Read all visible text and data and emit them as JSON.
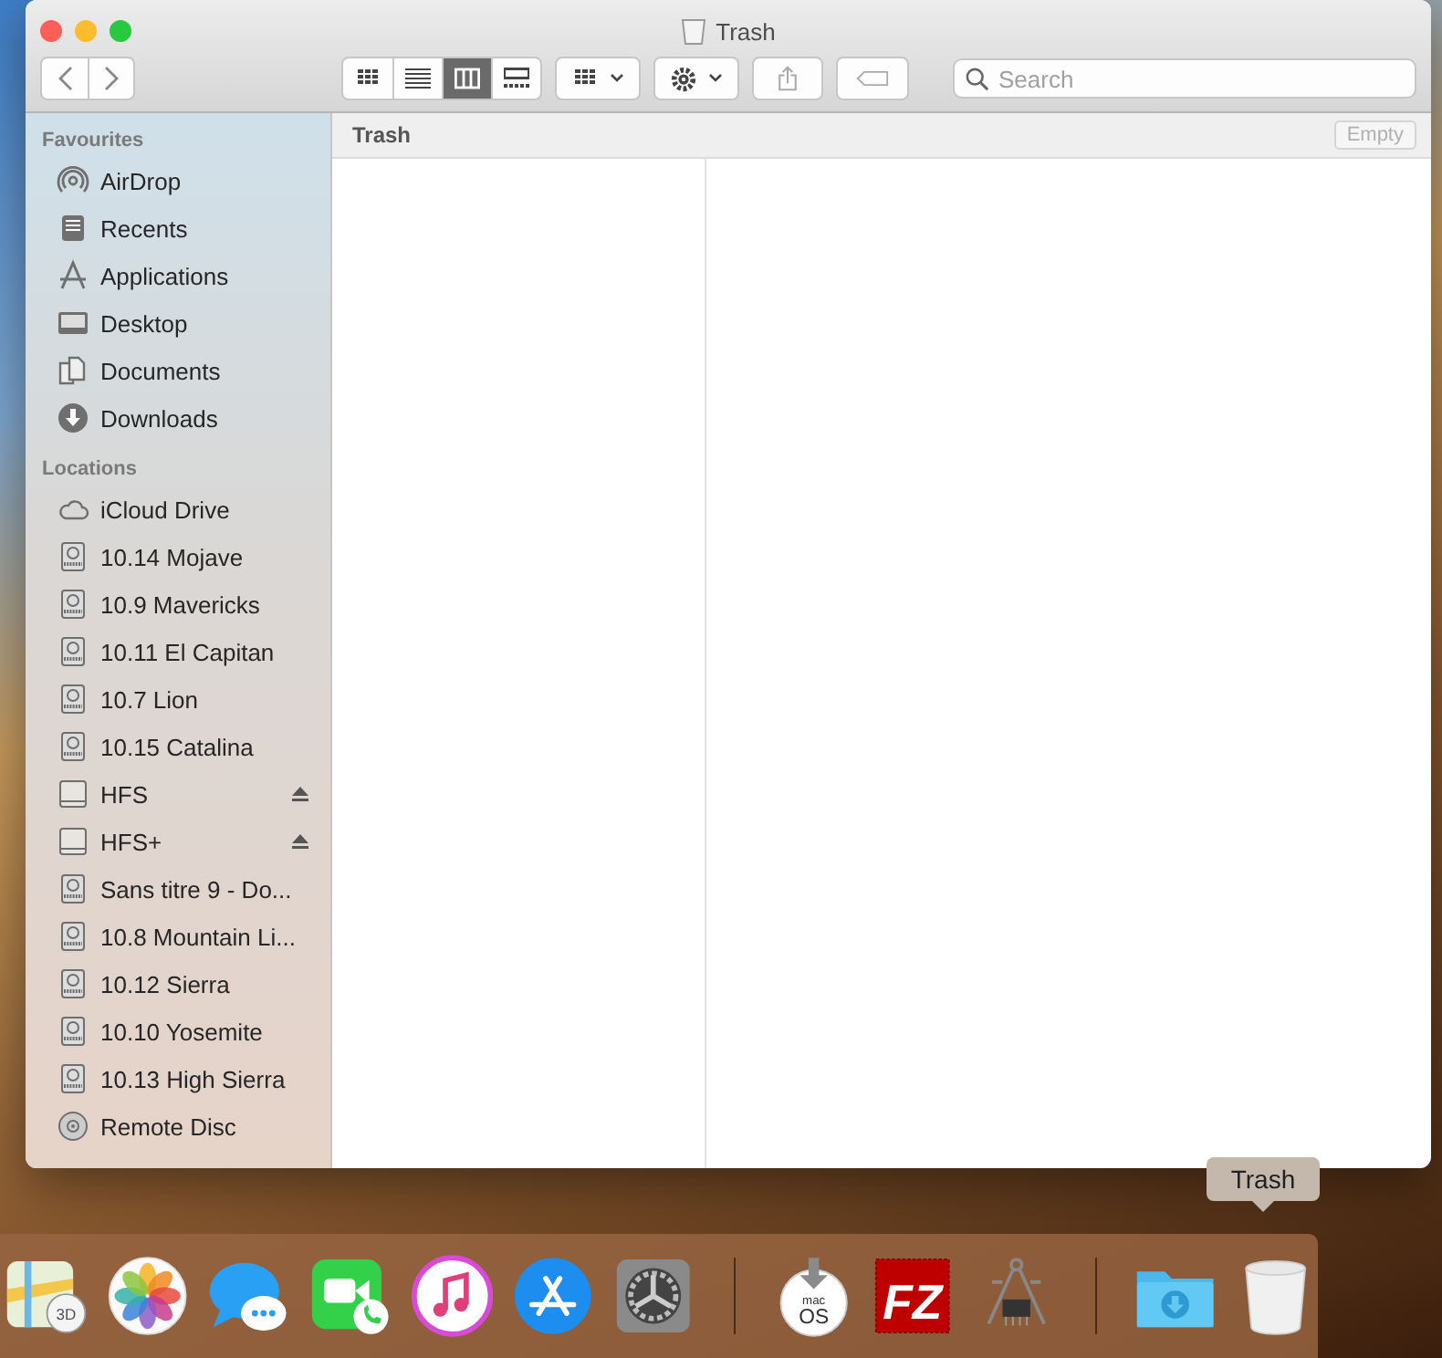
{
  "window": {
    "title": "Trash"
  },
  "toolbar": {
    "views": [
      {
        "kind": "icons",
        "selected": false
      },
      {
        "kind": "list",
        "selected": false
      },
      {
        "kind": "columns",
        "selected": true
      },
      {
        "kind": "gallery",
        "selected": false
      }
    ],
    "search": {
      "placeholder": "Search"
    }
  },
  "sidebar": {
    "sections": [
      {
        "title": "Favourites",
        "items": [
          {
            "label": "AirDrop",
            "kind": "airdrop",
            "ejectable": false
          },
          {
            "label": "Recents",
            "kind": "recents",
            "ejectable": false
          },
          {
            "label": "Applications",
            "kind": "applications",
            "ejectable": false
          },
          {
            "label": "Desktop",
            "kind": "desktop",
            "ejectable": false
          },
          {
            "label": "Documents",
            "kind": "documents",
            "ejectable": false
          },
          {
            "label": "Downloads",
            "kind": "downloads",
            "ejectable": false
          }
        ]
      },
      {
        "title": "Locations",
        "items": [
          {
            "label": "iCloud Drive",
            "kind": "cloud",
            "ejectable": false
          },
          {
            "label": "10.14 Mojave",
            "kind": "disk",
            "ejectable": false
          },
          {
            "label": "10.9 Mavericks",
            "kind": "disk",
            "ejectable": false
          },
          {
            "label": "10.11 El Capitan",
            "kind": "disk",
            "ejectable": false
          },
          {
            "label": "10.7 Lion",
            "kind": "disk",
            "ejectable": false
          },
          {
            "label": "10.15 Catalina",
            "kind": "disk",
            "ejectable": false
          },
          {
            "label": "HFS",
            "kind": "external",
            "ejectable": true
          },
          {
            "label": "HFS+",
            "kind": "external",
            "ejectable": true
          },
          {
            "label": "Sans titre 9 - Do...",
            "kind": "disk",
            "ejectable": false
          },
          {
            "label": "10.8 Mountain Li...",
            "kind": "disk",
            "ejectable": false
          },
          {
            "label": "10.12 Sierra",
            "kind": "disk",
            "ejectable": false
          },
          {
            "label": "10.10 Yosemite",
            "kind": "disk",
            "ejectable": false
          },
          {
            "label": "10.13 High Sierra",
            "kind": "disk",
            "ejectable": false
          },
          {
            "label": "Remote Disc",
            "kind": "disc",
            "ejectable": false
          }
        ]
      }
    ]
  },
  "path_bar": {
    "title": "Trash",
    "button": "Empty"
  },
  "dock": {
    "tooltip": "Trash",
    "items": [
      {
        "kind": "maps",
        "text": "3D"
      },
      {
        "kind": "photos"
      },
      {
        "kind": "messages"
      },
      {
        "kind": "facetime"
      },
      {
        "kind": "music"
      },
      {
        "kind": "appstore"
      },
      {
        "kind": "settings"
      },
      {
        "kind": "separator"
      },
      {
        "kind": "installer",
        "text": "mac",
        "text2": "OS"
      },
      {
        "kind": "filezilla",
        "text": "FZ"
      },
      {
        "kind": "sysinfo"
      },
      {
        "kind": "separator"
      },
      {
        "kind": "folder"
      },
      {
        "kind": "trash"
      }
    ]
  }
}
